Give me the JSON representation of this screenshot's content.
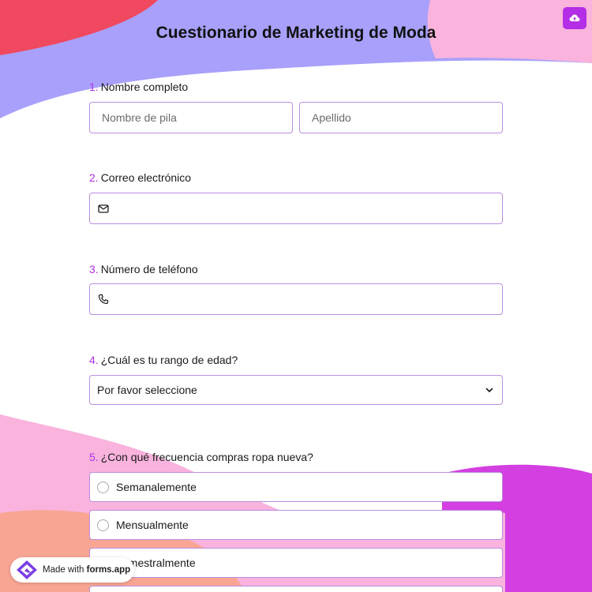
{
  "title": "Cuestionario de Marketing de Moda",
  "colors": {
    "accent": "#b32ee6",
    "border": "#b98de0",
    "blob_red": "#f0485e",
    "blob_lavender": "#a8a0fb",
    "blob_pink": "#f9b3dd",
    "blob_magenta": "#d33fe0",
    "blob_peach": "#f8a593"
  },
  "toolbar": {
    "upload_icon": "cloud-upload-icon"
  },
  "questions": {
    "q1": {
      "number": "1.",
      "label": "Nombre completo",
      "first_placeholder": "Nombre de pila",
      "last_placeholder": "Apellido"
    },
    "q2": {
      "number": "2.",
      "label": "Correo electrónico",
      "icon": "envelope-icon"
    },
    "q3": {
      "number": "3.",
      "label": "Número de teléfono",
      "icon": "phone-icon"
    },
    "q4": {
      "number": "4.",
      "label": "¿Cuál es tu rango de edad?",
      "selected": "Por favor seleccione",
      "icon": "chevron-down-icon"
    },
    "q5": {
      "number": "5.",
      "label": "¿Con qué frecuencia compras ropa nueva?",
      "options": [
        "Semanalemente",
        "Mensualmente",
        "Trimestralmente"
      ]
    }
  },
  "badge": {
    "prefix": "Made with ",
    "brand": "forms.app"
  }
}
